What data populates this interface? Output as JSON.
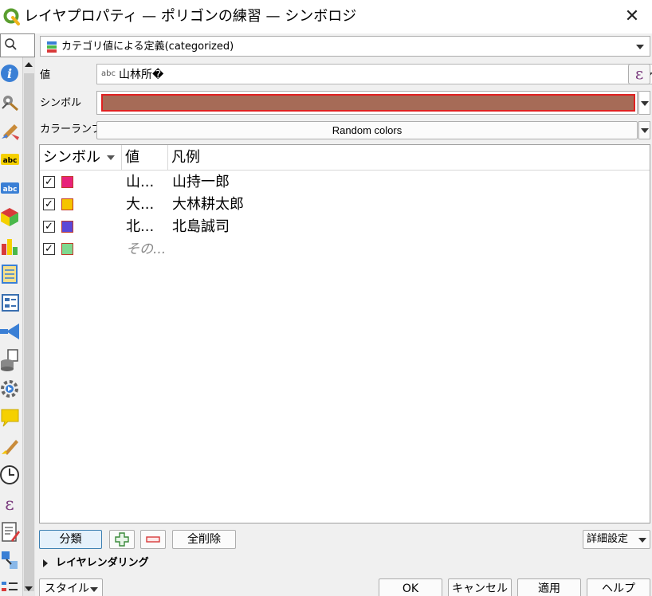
{
  "window": {
    "title": "レイヤプロパティ — ポリゴンの練習 — シンボロジ",
    "close_label": "✕"
  },
  "sidebar": {
    "icons": [
      "information-icon",
      "source-icon",
      "symbology-icon",
      "labels-icon",
      "masks-icon",
      "3d-view-icon",
      "diagrams-icon",
      "fields-icon",
      "attributes-form-icon",
      "joins-icon",
      "auxiliary-storage-icon",
      "actions-icon",
      "display-icon",
      "rendering-icon",
      "temporal-icon",
      "variables-icon",
      "metadata-icon",
      "dependencies-icon",
      "legend-icon"
    ]
  },
  "renderer": {
    "label": "カテゴリ値による定義(categorized)"
  },
  "value_row": {
    "label": "値",
    "type_badge": "abc",
    "value": "山林所�"
  },
  "symbol_row": {
    "label": "シンボル",
    "color": "#a66b57"
  },
  "ramp_row": {
    "label": "カラーランプ",
    "value": "Random colors"
  },
  "table": {
    "headers": {
      "symbol": "シンボル",
      "value": "値",
      "legend": "凡例"
    },
    "rows": [
      {
        "checked": "✓",
        "color": "#e8227a",
        "value": "山...",
        "legend": "山持一郎"
      },
      {
        "checked": "✓",
        "color": "#f5c400",
        "value": "大...",
        "legend": "大林耕太郎"
      },
      {
        "checked": "✓",
        "color": "#5b48d8",
        "value": "北...",
        "legend": "北島誠司"
      },
      {
        "checked": "✓",
        "color": "#7fd88f",
        "value": "その...",
        "legend": ""
      }
    ]
  },
  "buttons": {
    "classify": "分類",
    "delete_all": "全削除",
    "advanced": "詳細設定"
  },
  "layer_rendering": {
    "label": "レイヤレンダリング"
  },
  "bottom": {
    "style": "スタイル",
    "ok": "OK",
    "cancel": "キャンセル",
    "apply": "適用",
    "help": "ヘルプ"
  }
}
